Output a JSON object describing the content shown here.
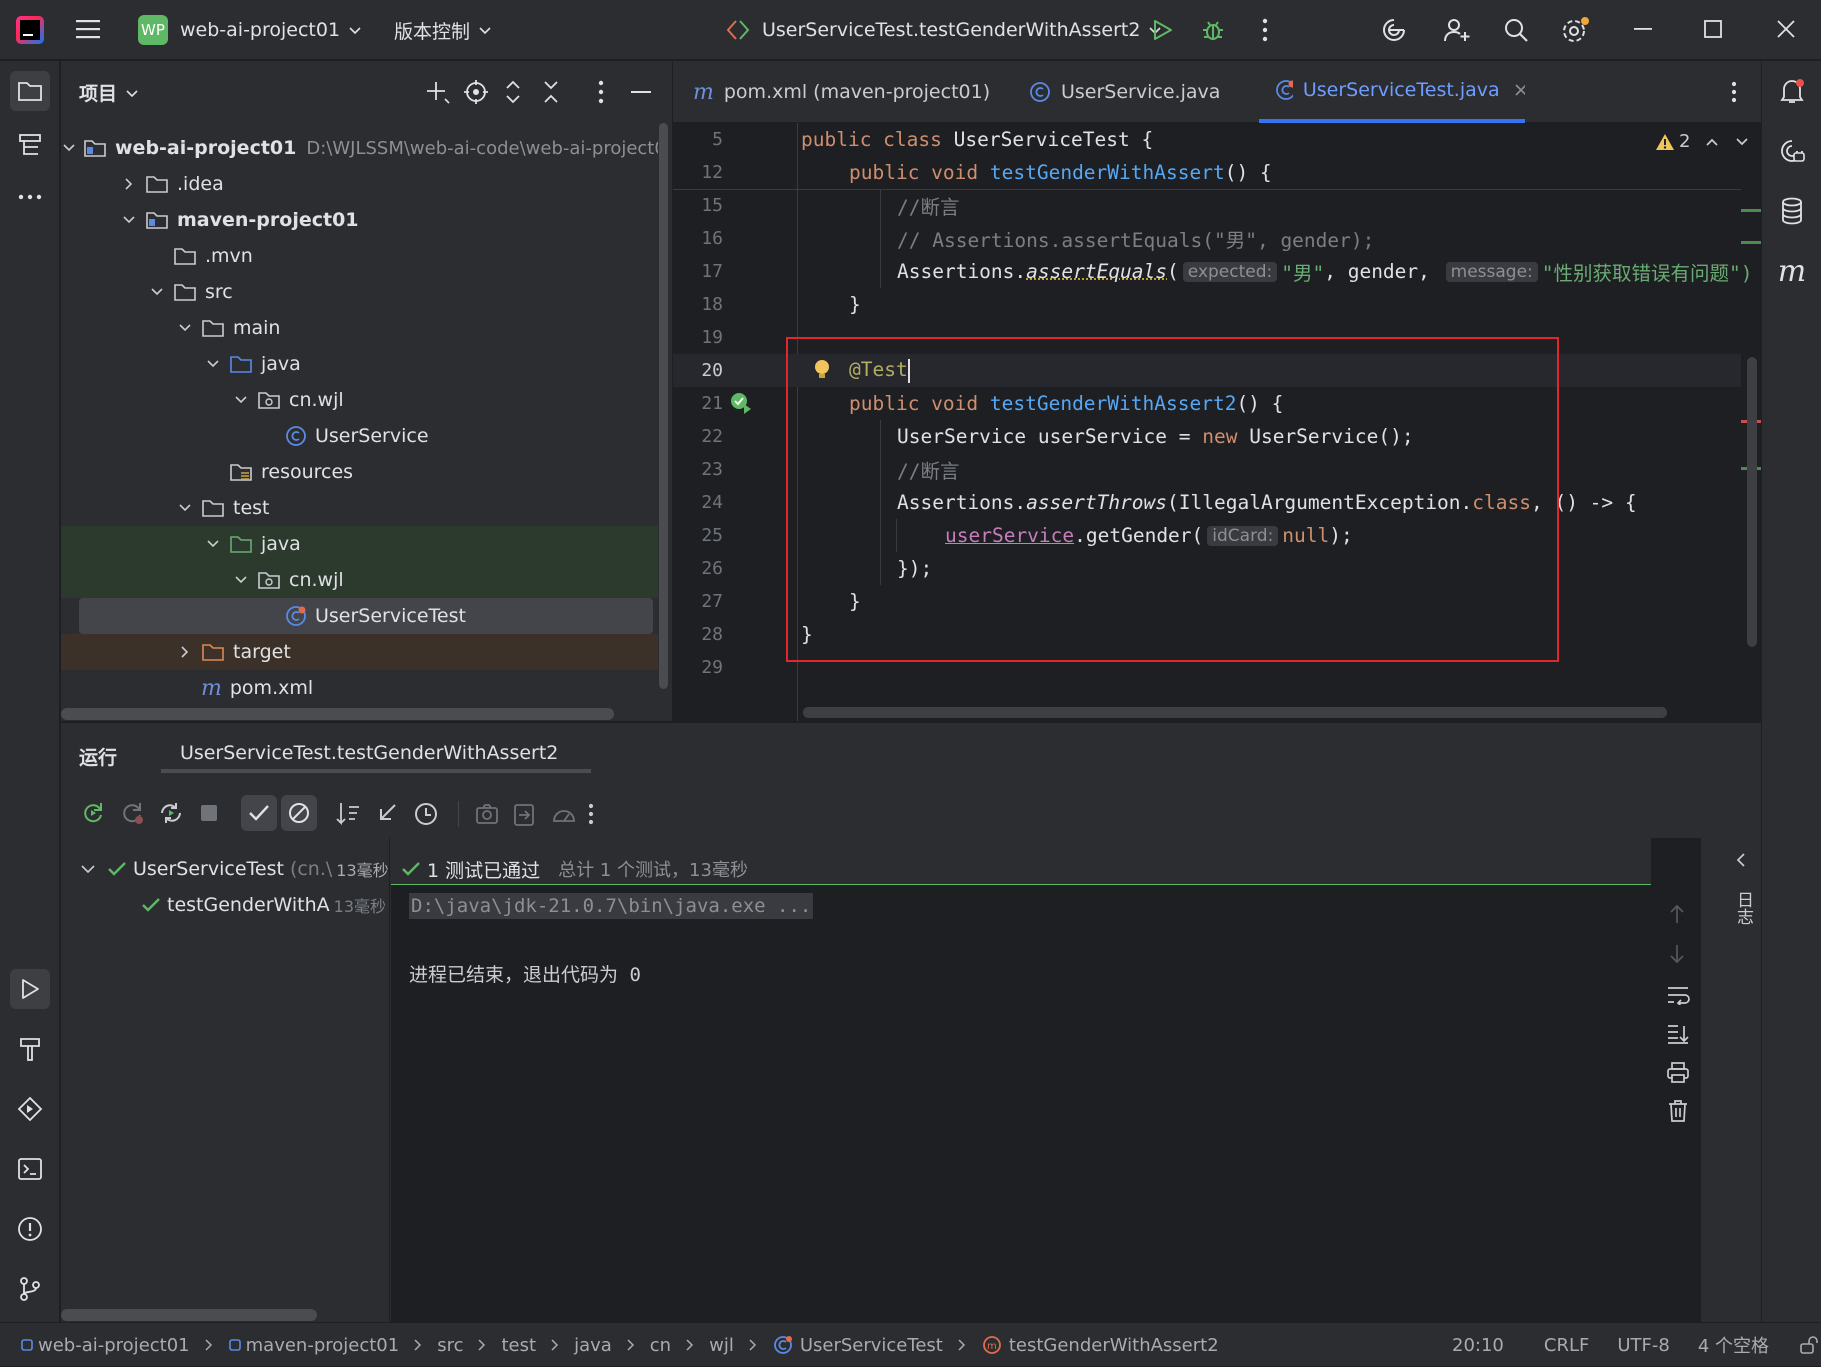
{
  "titlebar": {
    "project_badge": "WP",
    "project_name": "web-ai-project01",
    "vcs_label": "版本控制",
    "run_config": "UserServiceTest.testGenderWithAssert2"
  },
  "project_panel": {
    "title": "项目",
    "tree": [
      {
        "label": "web-ai-project01",
        "path": "D:\\WJLSSM\\web-ai-code\\web-ai-project01",
        "bold": true
      },
      {
        "label": ".idea"
      },
      {
        "label": "maven-project01",
        "bold": true
      },
      {
        "label": ".mvn"
      },
      {
        "label": "src"
      },
      {
        "label": "main"
      },
      {
        "label": "java"
      },
      {
        "label": "cn.wjl"
      },
      {
        "label": "UserService"
      },
      {
        "label": "resources"
      },
      {
        "label": "test"
      },
      {
        "label": "java"
      },
      {
        "label": "cn.wjl"
      },
      {
        "label": "UserServiceTest"
      },
      {
        "label": "target"
      },
      {
        "label": "pom.xml"
      }
    ]
  },
  "editor": {
    "tabs": [
      {
        "label": "pom.xml (maven-project01)"
      },
      {
        "label": "UserService.java"
      },
      {
        "label": "UserServiceTest.java"
      }
    ],
    "warning_count": "2",
    "line_numbers": [
      "5",
      "12",
      "15",
      "16",
      "17",
      "18",
      "19",
      "20",
      "21",
      "22",
      "23",
      "24",
      "25",
      "26",
      "27",
      "28",
      "29"
    ],
    "code": {
      "l5_kw": "public class ",
      "l5_name": "UserServiceTest {",
      "l12_kw": "public void ",
      "l12_fn": "testGenderWithAssert",
      "l12_rest": "() {",
      "l15": "//断言",
      "l16": "// Assertions.assertEquals(\"男\", gender);",
      "l17_a": "Assertions.",
      "l17_m": "assertEquals",
      "l17_p": "(",
      "l17_h1": "expected:",
      "l17_s1": "\"男\"",
      "l17_mid": ", gender, ",
      "l17_h2": "message:",
      "l17_s2": "\"性别获取错误有问题\")",
      "l18": "}",
      "l20": "@Test",
      "l21_kw": "public void ",
      "l21_fn": "testGenderWithAssert2",
      "l21_rest": "() {",
      "l22_a": "UserService userService = ",
      "l22_kw": "new",
      "l22_b": " UserService();",
      "l23": "//断言",
      "l24_a": "Assertions.",
      "l24_m": "assertThrows",
      "l24_b": "(IllegalArgumentException.",
      "l24_kw": "class",
      "l24_c": ", () -> {",
      "l25_v": "userService",
      "l25_a": ".getGender(",
      "l25_h": "idCard:",
      "l25_kw": "null",
      "l25_b": ");",
      "l26": "});",
      "l27": "}",
      "l28": "}"
    }
  },
  "run_panel": {
    "title": "运行",
    "tab": "UserServiceTest.testGenderWithAssert2",
    "tree_root": "UserServiceTest",
    "tree_root_pkg": "(cn.\\",
    "tree_root_time": "13毫秒",
    "tree_child": "testGenderWithA",
    "tree_child_time": "13毫秒",
    "result": "1 测试已通过",
    "result_detail": "总计 1 个测试，13毫秒",
    "console_cmd": "D:\\java\\jdk-21.0.7\\bin\\java.exe ...",
    "console_exit": "进程已结束，退出代码为 0",
    "side_label": "日志"
  },
  "statusbar": {
    "breadcrumbs": [
      "web-ai-project01",
      "maven-project01",
      "src",
      "test",
      "java",
      "cn",
      "wjl",
      "UserServiceTest",
      "testGenderWithAssert2"
    ],
    "position": "20:10",
    "line_sep": "CRLF",
    "encoding": "UTF-8",
    "indent": "4 个空格"
  },
  "colors": {
    "accent": "#3574f0",
    "pass": "#5fb865",
    "highlight_box": "#e0272c"
  }
}
